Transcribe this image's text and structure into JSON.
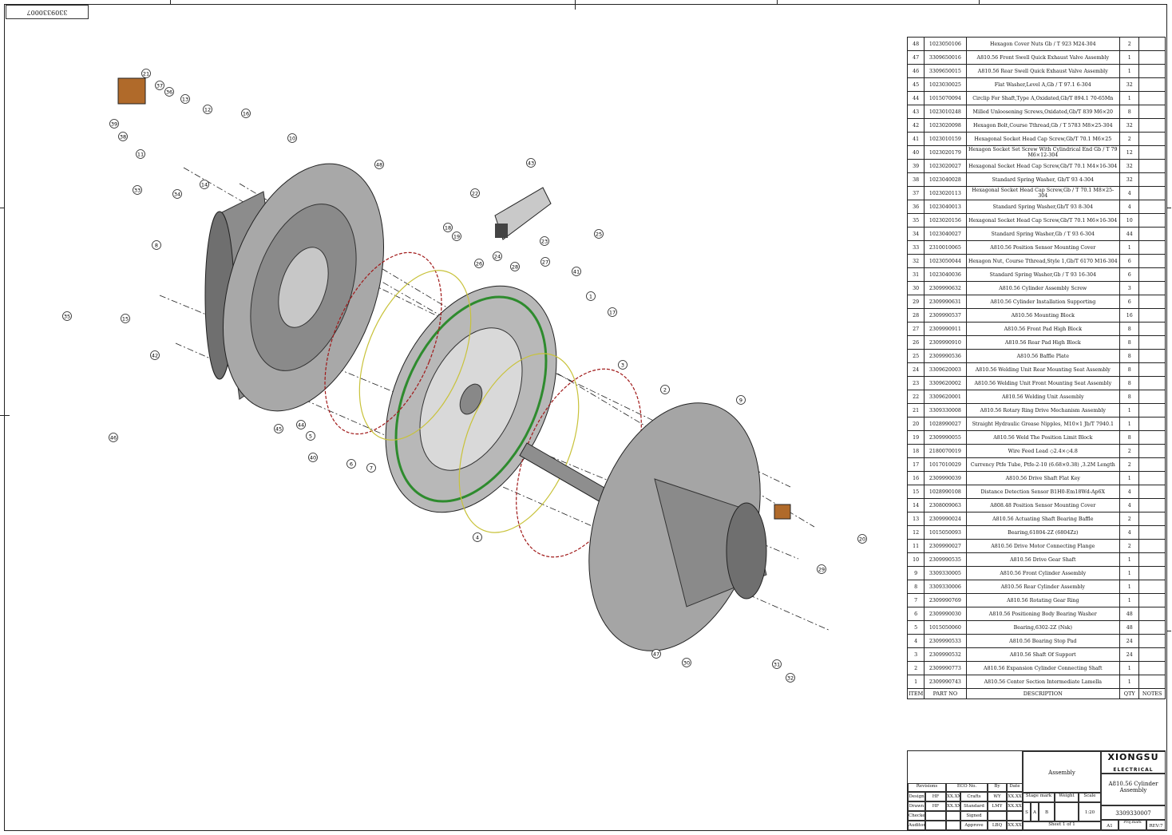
{
  "drawing_code_stamp": "3309330007",
  "drawing_title": "A810.56 Cylinder Assembly",
  "balloons": [
    "1",
    "2",
    "3",
    "4",
    "5",
    "6",
    "7",
    "8",
    "9",
    "10",
    "11",
    "12",
    "13",
    "14",
    "15",
    "16",
    "17",
    "18",
    "19",
    "20",
    "21",
    "22",
    "23",
    "24",
    "25",
    "26",
    "27",
    "28",
    "29",
    "30",
    "31",
    "32",
    "33",
    "34",
    "35",
    "36",
    "37",
    "38",
    "39",
    "40",
    "41",
    "42",
    "43",
    "44",
    "45",
    "46",
    "47",
    "48"
  ],
  "bom": {
    "headers": {
      "item": "ITEM",
      "part_no": "PART NO",
      "description": "DESCRIPTION",
      "qty": "QTY",
      "notes": "NOTES"
    },
    "rows": [
      {
        "item": "48",
        "pn": "1023050106",
        "desc": "Hexagon Cover Nuts  Gb / T 923 M24-304",
        "qty": "2"
      },
      {
        "item": "47",
        "pn": "3309650016",
        "desc": "A810.56 Front Swell Quick Exhaust Valve Assembly",
        "qty": "1"
      },
      {
        "item": "46",
        "pn": "3309650015",
        "desc": "A810.56 Rear Swell Quick Exhaust Valve Assembly",
        "qty": "1"
      },
      {
        "item": "45",
        "pn": "1023030025",
        "desc": "Flat Washer,Level A,Gb / T 97.1 6-304",
        "qty": "32"
      },
      {
        "item": "44",
        "pn": "1015070094",
        "desc": "Circlip For Shaft,Type A,Oxidated,Gb/T 894.1 70-65Mn",
        "qty": "1"
      },
      {
        "item": "43",
        "pn": "1023010248",
        "desc": "Milled Unloosening Screws,Oxidated,Gb/T 839 M6×20",
        "qty": "8"
      },
      {
        "item": "42",
        "pn": "1023020098",
        "desc": "Hexagon Bolt,Course Tthread,Gb / T 5783 M8×25-304",
        "qty": "32"
      },
      {
        "item": "41",
        "pn": "1023010159",
        "desc": "Hexagonal Socket Head Cap Screw,Gb/T 70.1 M6×25",
        "qty": "2"
      },
      {
        "item": "40",
        "pn": "1023020179",
        "desc": "Hexagon Socket Set Screw With Cylindrical End Gb / T 79 M6×12-304",
        "qty": "12"
      },
      {
        "item": "39",
        "pn": "1023020027",
        "desc": "Hexagonal Socket Head Cap Screw,Gb/T 70.1 M4×16-304",
        "qty": "32"
      },
      {
        "item": "38",
        "pn": "1023040028",
        "desc": "Standard Spring Washer, Gb/T 93 4-304",
        "qty": "32"
      },
      {
        "item": "37",
        "pn": "1023020113",
        "desc": "Hexagonal Socket Head Cap Screw,Gb / T 70.1 M8×25-304",
        "qty": "4"
      },
      {
        "item": "36",
        "pn": "1023040013",
        "desc": "Standard Spring Washer,Gb/T 93 8-304",
        "qty": "4"
      },
      {
        "item": "35",
        "pn": "1023020156",
        "desc": "Hexagonal Socket Head Cap Screw,Gb/T 70.1 M6×16-304",
        "qty": "10"
      },
      {
        "item": "34",
        "pn": "1023040027",
        "desc": "Standard Spring Washer,Gb / T 93 6-304",
        "qty": "44"
      },
      {
        "item": "33",
        "pn": "2310010065",
        "desc": "A810.56 Position Sensor Mounting Cover",
        "qty": "1"
      },
      {
        "item": "32",
        "pn": "1023050044",
        "desc": "Hexagon Nut, Course Tthread,Style 1,Gb/T 6170 M16-304",
        "qty": "6"
      },
      {
        "item": "31",
        "pn": "1023040036",
        "desc": "Standard Spring Washer,Gb / T 93 16-304",
        "qty": "6"
      },
      {
        "item": "30",
        "pn": "2309990632",
        "desc": "A810.56 Cylinder Assembly Screw",
        "qty": "3"
      },
      {
        "item": "29",
        "pn": "2309990631",
        "desc": "A810.56 Cylinder Installation Supporting",
        "qty": "6"
      },
      {
        "item": "28",
        "pn": "2309990537",
        "desc": "A810.56 Mounting Block",
        "qty": "16"
      },
      {
        "item": "27",
        "pn": "2309990911",
        "desc": "A810.56 Front Pad High Block",
        "qty": "8"
      },
      {
        "item": "26",
        "pn": "2309990910",
        "desc": "A810.56 Rear Pad High Block",
        "qty": "8"
      },
      {
        "item": "25",
        "pn": "2309990536",
        "desc": "A810.56  Baffle Plate",
        "qty": "8"
      },
      {
        "item": "24",
        "pn": "3309620003",
        "desc": "A810.56 Welding Unit Rear Mounting Seat Assembly",
        "qty": "8"
      },
      {
        "item": "23",
        "pn": "3309620002",
        "desc": "A810.56  Welding Unit Front Mounting Seat Assembly",
        "qty": "8"
      },
      {
        "item": "22",
        "pn": "3309620001",
        "desc": "A810.56 Welding Unit Assembly",
        "qty": "8"
      },
      {
        "item": "21",
        "pn": "3309330008",
        "desc": "A810.56 Rotary Ring Drive Mechanism Assembly",
        "qty": "1"
      },
      {
        "item": "20",
        "pn": "1028990027",
        "desc": "Straight Hydraulic Grease Nipples, M10×1 Jb/T 7940.1",
        "qty": "1"
      },
      {
        "item": "19",
        "pn": "2309990055",
        "desc": "A810.56 Weld The Position Limit Block",
        "qty": "8"
      },
      {
        "item": "18",
        "pn": "2180070019",
        "desc": "Wire Feed Lead  ◇2.4×◇4.8",
        "qty": "2"
      },
      {
        "item": "17",
        "pn": "1017010029",
        "desc": "Currency Ptfe Tube, Ptfe-2-10 (6.68×0.38) ,3.2M Length",
        "qty": "2"
      },
      {
        "item": "16",
        "pn": "2309990039",
        "desc": "A810.56 Drive Shaft Flat Key",
        "qty": "1"
      },
      {
        "item": "15",
        "pn": "1028990108",
        "desc": "Distance Detection Sensor B1H0-Em18Wd-Ap6X",
        "qty": "4"
      },
      {
        "item": "14",
        "pn": "2308009063",
        "desc": "A808.48 Position Sensor Mounting Cover",
        "qty": "4"
      },
      {
        "item": "13",
        "pn": "2309990024",
        "desc": "A810.56 Actuating Shaft Bearing Baffle",
        "qty": "2"
      },
      {
        "item": "12",
        "pn": "1015050093",
        "desc": "Bearing,61804-2Z (6804Zz)",
        "qty": "4"
      },
      {
        "item": "11",
        "pn": "2309990027",
        "desc": "A810.56 Drive Motor Connecting Flange",
        "qty": "2"
      },
      {
        "item": "10",
        "pn": "2309990535",
        "desc": "A810.56 Drive Gear Shaft",
        "qty": "1"
      },
      {
        "item": "9",
        "pn": "3309330005",
        "desc": "A810.56 Front Cylinder Assembly",
        "qty": "1"
      },
      {
        "item": "8",
        "pn": "3309330006",
        "desc": "A810.56 Rear Cylinder Assembly",
        "qty": "1"
      },
      {
        "item": "7",
        "pn": "2309990769",
        "desc": "A810.56 Rotating Gear Ring",
        "qty": "1"
      },
      {
        "item": "6",
        "pn": "2309990030",
        "desc": "A810.56 Positioning Body Bearing Washer",
        "qty": "48"
      },
      {
        "item": "5",
        "pn": "1015050060",
        "desc": "Bearing,6302-2Z (Nsk)",
        "qty": "48"
      },
      {
        "item": "4",
        "pn": "2309990533",
        "desc": "A810.56 Bearing Stop Pad",
        "qty": "24"
      },
      {
        "item": "3",
        "pn": "2309990532",
        "desc": "A810.56 Shaft Of Support",
        "qty": "24"
      },
      {
        "item": "2",
        "pn": "2309990773",
        "desc": "A810.56 Expansion Cylinder Connecting Shaft",
        "qty": "1"
      },
      {
        "item": "1",
        "pn": "2309990743",
        "desc": "A810.56 Center Section Intermediate Lamella",
        "qty": "1"
      }
    ]
  },
  "title_block": {
    "logo": "XIONGSU",
    "logo_sub": "ELECTRICAL",
    "type_label": "Assembly",
    "revisions": "Revisions",
    "ecn": "ECO No.",
    "by": "By",
    "date": "Date",
    "roles": [
      {
        "role": "Design",
        "name": "HF",
        "date": "XX.XX",
        "role2": "Crafts",
        "name2": "WY",
        "date2": "XX.XX"
      },
      {
        "role": "Drawn",
        "name": "HF",
        "date": "XX.XX",
        "role2": "Standard",
        "name2": "LMY",
        "date2": "XX.XX"
      },
      {
        "role": "Checked",
        "name": "",
        "date": "",
        "role2": "Signed",
        "name2": "",
        "date2": ""
      },
      {
        "role": "Auditor",
        "name": "",
        "date": "",
        "role2": "Approve",
        "name2": "LBQ",
        "date2": "XX.XX"
      }
    ],
    "stage_mark": "Stage mark",
    "weight": "Weight",
    "scale": "Scale",
    "stage_letters": [
      "S",
      "A",
      "B"
    ],
    "scale_value": "1:20",
    "sheet": "Sheet  1  of  1",
    "title": "A810.56 Cylinder Assembly",
    "code": "3309330007",
    "size": "A1",
    "proj_mark": "Proj.mark",
    "rev": "REV:7"
  },
  "colors": {
    "line": "#222222",
    "gear_green": "#2e8b2e",
    "ring_red": "#a01818",
    "ring_yellow": "#c8c23a",
    "metal": "#9a9a9a",
    "dark_metal": "#555555",
    "copper": "#b06a2a"
  }
}
